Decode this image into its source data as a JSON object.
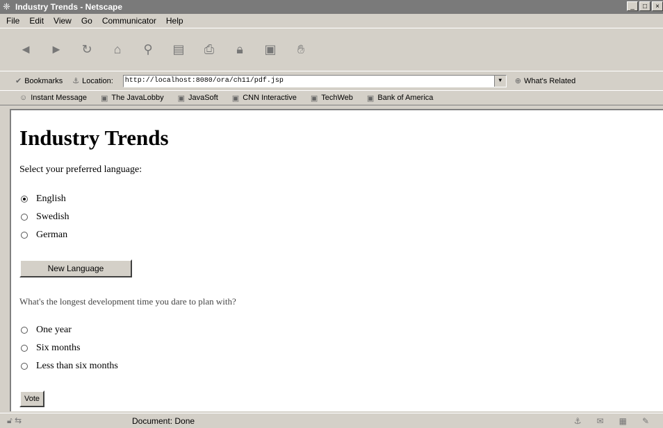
{
  "window": {
    "title": "Industry Trends - Netscape",
    "controls": [
      "_",
      "□",
      "×"
    ]
  },
  "menu": [
    "File",
    "Edit",
    "View",
    "Go",
    "Communicator",
    "Help"
  ],
  "navigation": {
    "bookmarks_label": "Bookmarks",
    "location_label": "Location:",
    "url": "http://localhost:8080/ora/ch11/pdf.jsp",
    "related_label": "What's Related"
  },
  "personal_toolbar": [
    "Instant Message",
    "The JavaLobby",
    "JavaSoft",
    "CNN Interactive",
    "TechWeb",
    "Bank of America"
  ],
  "page": {
    "heading": "Industry Trends",
    "language_prompt": "Select your preferred language:",
    "languages": [
      {
        "label": "English",
        "selected": true
      },
      {
        "label": "Swedish",
        "selected": false
      },
      {
        "label": "German",
        "selected": false
      }
    ],
    "new_language_button": "New Language",
    "question": "What's the longest development time you dare to plan with?",
    "options": [
      {
        "label": "One year",
        "selected": false
      },
      {
        "label": "Six months",
        "selected": false
      },
      {
        "label": "Less than six months",
        "selected": false
      }
    ],
    "vote_button": "Vote"
  },
  "status": {
    "text": "Document: Done"
  }
}
